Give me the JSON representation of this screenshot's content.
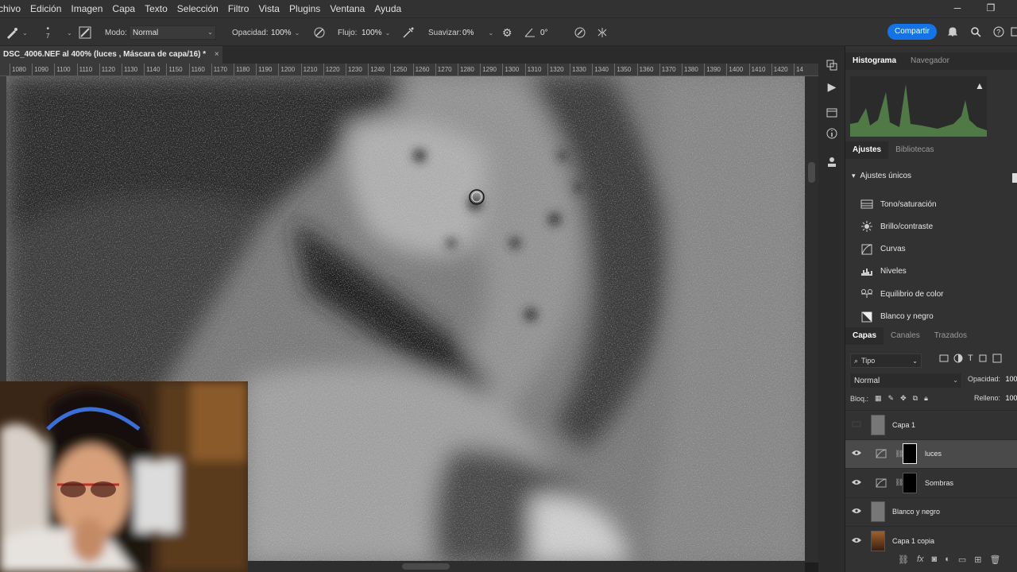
{
  "menu": [
    "chivo",
    "Edición",
    "Imagen",
    "Capa",
    "Texto",
    "Selección",
    "Filtro",
    "Vista",
    "Plugins",
    "Ventana",
    "Ayuda"
  ],
  "options": {
    "brush_size": "7",
    "mode_label": "Modo:",
    "mode_value": "Normal",
    "opacity_label": "Opacidad:",
    "opacity_value": "100%",
    "flow_label": "Flujo:",
    "flow_value": "100%",
    "smooth_label": "Suavizar:",
    "smooth_value": "0%",
    "angle_value": "0°",
    "share_label": "Compartir"
  },
  "document": {
    "tab_title": "DSC_4006.NEF al 400% (luces , Máscara de capa/16) *",
    "close_glyph": "×"
  },
  "ruler_ticks": [
    "1080",
    "1090",
    "1100",
    "1110",
    "1120",
    "1130",
    "1140",
    "1150",
    "1160",
    "1170",
    "1180",
    "1190",
    "1200",
    "1210",
    "1220",
    "1230",
    "1240",
    "1250",
    "1260",
    "1270",
    "1280",
    "1290",
    "1300",
    "1310",
    "1320",
    "1330",
    "1340",
    "1350",
    "1360",
    "1370",
    "1380",
    "1390",
    "1400",
    "1410",
    "1420",
    "14"
  ],
  "panels": {
    "histogram_tab": "Histograma",
    "navigator_tab": "Navegador",
    "adjust_tab": "Ajustes",
    "libraries_tab": "Bibliotecas",
    "adjust_group": "Ajustes únicos",
    "adjustments": [
      {
        "label": "Tono/saturación",
        "icon": "hue-saturation-icon"
      },
      {
        "label": "Brillo/contraste",
        "icon": "brightness-icon"
      },
      {
        "label": "Curvas",
        "icon": "curves-icon"
      },
      {
        "label": "Niveles",
        "icon": "levels-icon"
      },
      {
        "label": "Equilibrio de color",
        "icon": "color-balance-icon"
      },
      {
        "label": "Blanco y negro",
        "icon": "black-white-icon"
      }
    ],
    "layers_tab": "Capas",
    "channels_tab": "Canales",
    "paths_tab": "Trazados",
    "filter_label": "Tipo",
    "blend_mode": "Normal",
    "opacity_label": "Opacidad:",
    "opacity_value": "100",
    "lock_label": "Bloq.:",
    "fill_label": "Relleno:",
    "fill_value": "100"
  },
  "layers": [
    {
      "name": "Capa 1",
      "visible": false,
      "selected": false,
      "kind": "pixel"
    },
    {
      "name": "luces",
      "visible": true,
      "selected": true,
      "kind": "adjust-mask"
    },
    {
      "name": "Sombras",
      "visible": true,
      "selected": false,
      "kind": "adjust-mask"
    },
    {
      "name": "Blanco y negro",
      "visible": true,
      "selected": false,
      "kind": "pixel"
    },
    {
      "name": "Capa 1 copia",
      "visible": true,
      "selected": false,
      "kind": "photo"
    }
  ],
  "colors": {
    "accent": "#1473e6",
    "panel_bg": "#323232",
    "selected_row": "#4a4a4a"
  }
}
